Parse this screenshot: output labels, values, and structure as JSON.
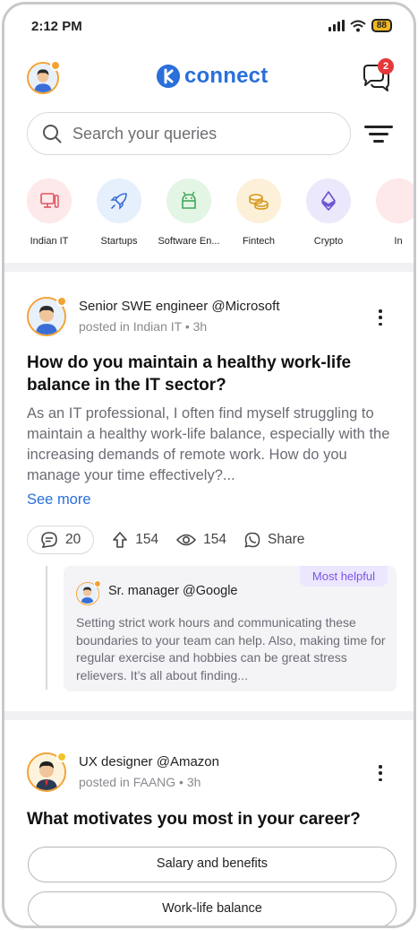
{
  "status_bar": {
    "time": "2:12 PM",
    "battery": "88"
  },
  "header": {
    "logo_text": "connect",
    "chat_badge_count": "2"
  },
  "search": {
    "placeholder": "Search your queries"
  },
  "categories": [
    {
      "label": "Indian IT",
      "icon": "desktop-icon",
      "bg": "#fde8ea",
      "fg": "#e0525c"
    },
    {
      "label": "Startups",
      "icon": "rocket-icon",
      "bg": "#e6effc",
      "fg": "#3a6ed6"
    },
    {
      "label": "Software En...",
      "icon": "android-icon",
      "bg": "#e3f5e4",
      "fg": "#3ea85a"
    },
    {
      "label": "Fintech",
      "icon": "coins-icon",
      "bg": "#fdf0d9",
      "fg": "#d69a1e"
    },
    {
      "label": "Crypto",
      "icon": "ethereum-icon",
      "bg": "#ece8fb",
      "fg": "#6a4fd4"
    },
    {
      "label": "In",
      "icon": "partial-icon",
      "bg": "#fde8ea",
      "fg": "#e0525c"
    }
  ],
  "post1": {
    "author": "Senior SWE engineer @Microsoft",
    "posted": "posted in Indian IT • 3h",
    "title": "How do you maintain a healthy work-life balance in the IT sector?",
    "body": "As an IT professional, I often find myself struggling to maintain a healthy work-life balance, especially with the increasing demands of remote work. How do you manage your time effectively?...",
    "see_more": "See more",
    "comments": "20",
    "upvotes": "154",
    "views": "154",
    "share": "Share",
    "reply": {
      "badge": "Most helpful",
      "author": "Sr. manager @Google",
      "body": "Setting strict work hours and communicating these boundaries to your team can help. Also, making time for regular exercise and hobbies can be great stress relievers. It’s all about finding..."
    }
  },
  "post2": {
    "author": "UX designer @Amazon",
    "posted": "posted in FAANG • 3h",
    "title": "What motivates you most in your career?",
    "options": [
      "Salary and benefits",
      "Work-life balance"
    ]
  },
  "colors": {
    "accent": "#2a6fdb",
    "badge": "#e5383b",
    "avatar_ring": "#f4a236",
    "helpful": "#7a55e8"
  }
}
